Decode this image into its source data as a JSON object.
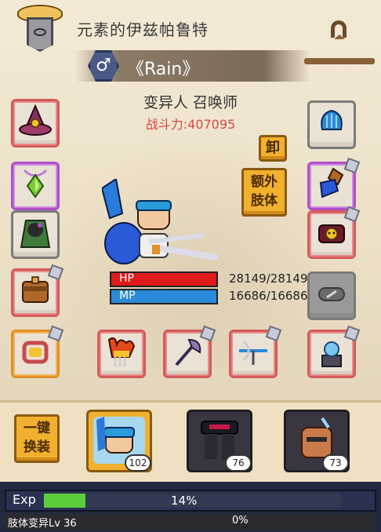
{
  "header": {
    "world_title": "元素的伊兹帕鲁特",
    "gender_symbol": "♂",
    "player_name": "《Rain》",
    "job": "变异人 召唤师",
    "power_label": "战斗力:407095"
  },
  "buttons": {
    "unequip": "卸",
    "extra_limb_1": "额外",
    "extra_limb_2": "肢体",
    "one_key_1": "一键",
    "one_key_2": "换装"
  },
  "stats": {
    "hp_label": "HP",
    "hp_value": "28149/28149",
    "hp_fraction": 1.0,
    "mp_label": "MP",
    "mp_value": "16686/16686",
    "mp_fraction": 1.0,
    "hp_color": "#e01a1a",
    "mp_color": "#2a8ad8"
  },
  "equipment": [
    {
      "slot": "hat",
      "icon": "wizard-hat-icon",
      "rarity": "red"
    },
    {
      "slot": "amulet",
      "icon": "green-gem-amulet-icon",
      "rarity": "purple"
    },
    {
      "slot": "armor",
      "icon": "green-cloak-icon",
      "rarity": "gray"
    },
    {
      "slot": "belt",
      "icon": "satchel-icon",
      "rarity": "red"
    },
    {
      "slot": "ring",
      "icon": "ring-icon",
      "rarity": "orange"
    },
    {
      "slot": "crest",
      "icon": "blue-crest-icon",
      "rarity": "gray"
    },
    {
      "slot": "gloves",
      "icon": "blue-gauntlet-icon",
      "rarity": "purple"
    },
    {
      "slot": "bracer",
      "icon": "skull-bracer-icon",
      "rarity": "red"
    },
    {
      "slot": "locked",
      "icon": "locked-slot-icon",
      "rarity": "gray"
    },
    {
      "slot": "boots",
      "icon": "pedestal-icon",
      "rarity": "red"
    },
    {
      "slot": "weapon-1",
      "icon": "fire-crown-icon",
      "rarity": "red"
    },
    {
      "slot": "weapon-2",
      "icon": "axe-icon",
      "rarity": "red"
    },
    {
      "slot": "weapon-3",
      "icon": "crossbow-icon",
      "rarity": "red"
    }
  ],
  "party": [
    {
      "name": "hero-summoner",
      "level": "102",
      "selected": true
    },
    {
      "name": "dark-armor",
      "level": "76",
      "selected": false
    },
    {
      "name": "bald-warrior",
      "level": "73",
      "selected": false
    }
  ],
  "exp": {
    "label": "Exp",
    "percent_text": "14%",
    "fraction": 0.14,
    "sub_label": "肢体变异Lv 36",
    "sub_percent": "0%"
  },
  "colors": {
    "panel_bg": "#efe4cf",
    "exp_fill": "#5ccc3a",
    "gold_button": "#f1b02e",
    "power_text": "#d24a4a"
  }
}
